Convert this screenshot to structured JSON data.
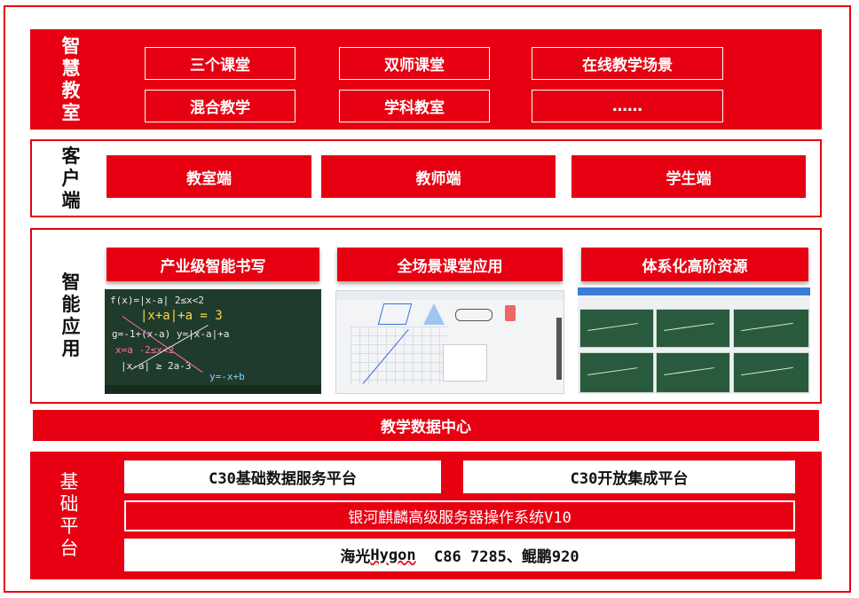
{
  "layers": {
    "classroom": {
      "label": [
        "智",
        "慧",
        "教",
        "室"
      ],
      "items": [
        "三个课堂",
        "双师课堂",
        "在线教学场景",
        "混合教学",
        "学科教室",
        "……"
      ]
    },
    "client": {
      "label": [
        "客",
        "户",
        "端"
      ],
      "items": [
        "教室端",
        "教师端",
        "学生端"
      ]
    },
    "apps": {
      "label": [
        "智",
        "能",
        "应",
        "用"
      ],
      "items": [
        "产业级智能书写",
        "全场景课堂应用",
        "体系化高阶资源"
      ]
    },
    "data_center": {
      "label": "教学数据中心"
    },
    "platform": {
      "label": [
        "基",
        "础",
        "平",
        "台"
      ],
      "row1": [
        "C30基础数据服务平台",
        "C30开放集成平台"
      ],
      "os": "银河麒麟高级服务器操作系统V10",
      "hw_prefix": "海光",
      "hw_hygon": "Hygon",
      "hw_rest": "  C86 7285、鲲鹏920"
    }
  },
  "colors": {
    "accent": "#e60012",
    "board": "#1f3b2b"
  }
}
